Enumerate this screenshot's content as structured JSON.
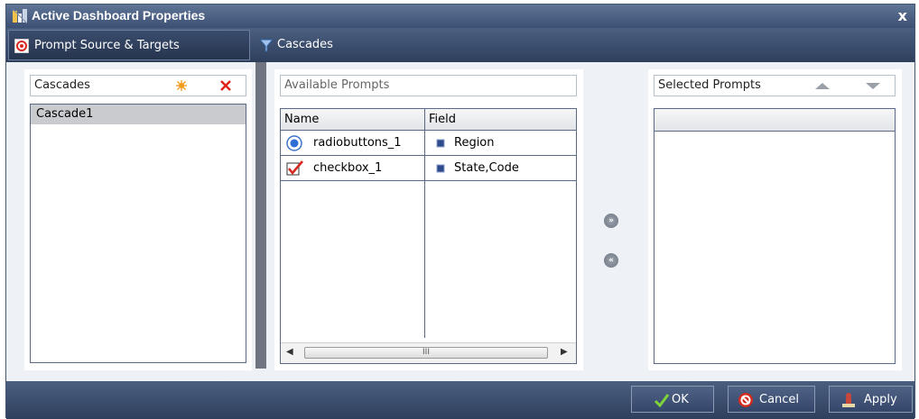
{
  "window": {
    "title": "Active Dashboard Properties",
    "close_label": "x"
  },
  "tabs": [
    {
      "label": "Prompt Source & Targets"
    },
    {
      "label": "Cascades"
    }
  ],
  "cascades": {
    "header": "Cascades",
    "items": [
      "Cascade1"
    ]
  },
  "available": {
    "header": "Available Prompts",
    "columns": [
      "Name",
      "Field"
    ],
    "rows": [
      {
        "name": "radiobuttons_1",
        "field": "Region",
        "icon": "radio-button-icon"
      },
      {
        "name": "checkbox_1",
        "field": "State,Code",
        "icon": "checkbox-icon"
      }
    ],
    "scroll_grip": "III"
  },
  "selected": {
    "header": "Selected Prompts"
  },
  "footer": {
    "ok_label": "OK",
    "cancel_label": "Cancel",
    "apply_label": "Apply"
  },
  "colors": {
    "title_bar": "#3c5073",
    "pane_bg": "#eef1f5",
    "selected_row": "#c9cbcf",
    "delete_red": "#e0241b",
    "new_orange": "#f29b1c"
  }
}
